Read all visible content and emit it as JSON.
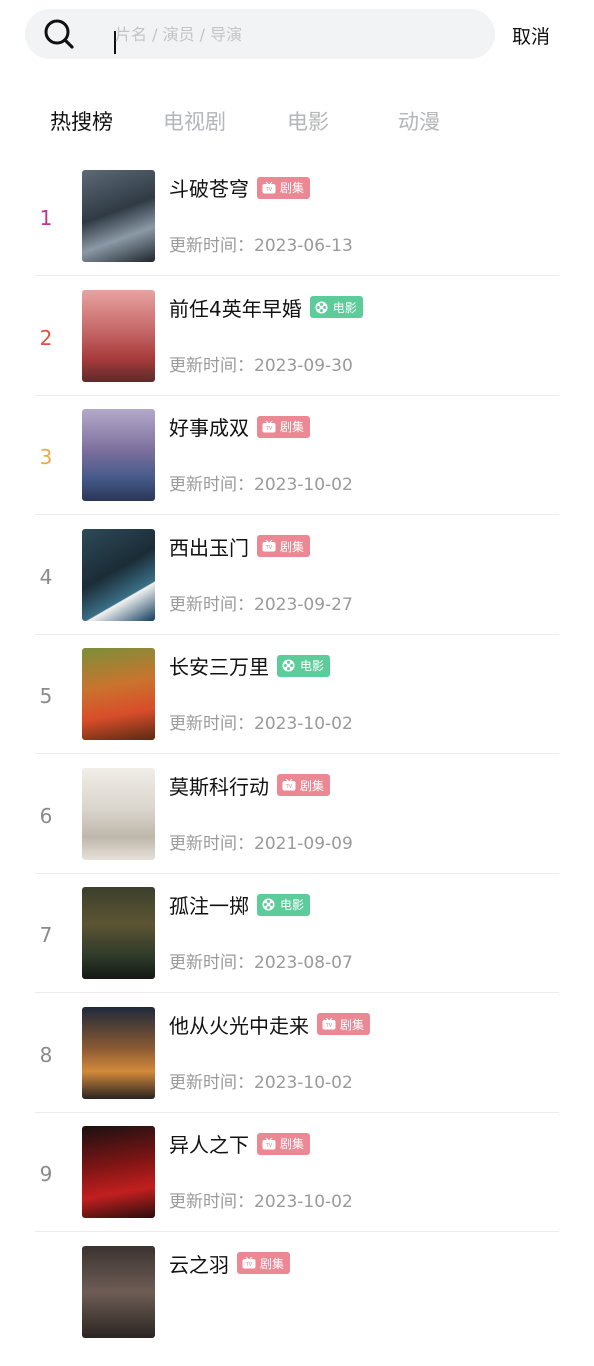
{
  "search": {
    "placeholder": "片名 / 演员 / 导演",
    "value": "",
    "cancel_label": "取消"
  },
  "tabs": [
    {
      "label": "热搜榜",
      "active": true
    },
    {
      "label": "电视剧",
      "active": false
    },
    {
      "label": "电影",
      "active": false
    },
    {
      "label": "动漫",
      "active": false
    }
  ],
  "colors": {
    "rank1": "#c0338f",
    "rank2": "#e0503d",
    "rank3": "#f0a84a",
    "rank_default": "#8a8a8a",
    "badge_drama": "#ec8893",
    "badge_movie": "#5ccc9a"
  },
  "list": [
    {
      "rank": "1",
      "title": "斗破苍穹",
      "badge": "剧集",
      "badge_type": "drama",
      "badge_icon": "tv-icon",
      "update": "更新时间：2023-06-13"
    },
    {
      "rank": "2",
      "title": "前任4英年早婚",
      "badge": "电影",
      "badge_type": "movie",
      "badge_icon": "film-reel-icon",
      "update": "更新时间：2023-09-30"
    },
    {
      "rank": "3",
      "title": "好事成双",
      "badge": "剧集",
      "badge_type": "drama",
      "badge_icon": "tv-icon",
      "update": "更新时间：2023-10-02"
    },
    {
      "rank": "4",
      "title": "西出玉门",
      "badge": "剧集",
      "badge_type": "drama",
      "badge_icon": "tv-icon",
      "update": "更新时间：2023-09-27"
    },
    {
      "rank": "5",
      "title": "长安三万里",
      "badge": "电影",
      "badge_type": "movie",
      "badge_icon": "film-reel-icon",
      "update": "更新时间：2023-10-02"
    },
    {
      "rank": "6",
      "title": "莫斯科行动",
      "badge": "剧集",
      "badge_type": "drama",
      "badge_icon": "tv-icon",
      "update": "更新时间：2021-09-09"
    },
    {
      "rank": "7",
      "title": "孤注一掷",
      "badge": "电影",
      "badge_type": "movie",
      "badge_icon": "film-reel-icon",
      "update": "更新时间：2023-08-07"
    },
    {
      "rank": "8",
      "title": "他从火光中走来",
      "badge": "剧集",
      "badge_type": "drama",
      "badge_icon": "tv-icon",
      "update": "更新时间：2023-10-02"
    },
    {
      "rank": "9",
      "title": "异人之下",
      "badge": "剧集",
      "badge_type": "drama",
      "badge_icon": "tv-icon",
      "update": "更新时间：2023-10-02"
    },
    {
      "rank": "",
      "title": "云之羽",
      "badge": "剧集",
      "badge_type": "drama",
      "badge_icon": "tv-icon",
      "update": ""
    }
  ]
}
